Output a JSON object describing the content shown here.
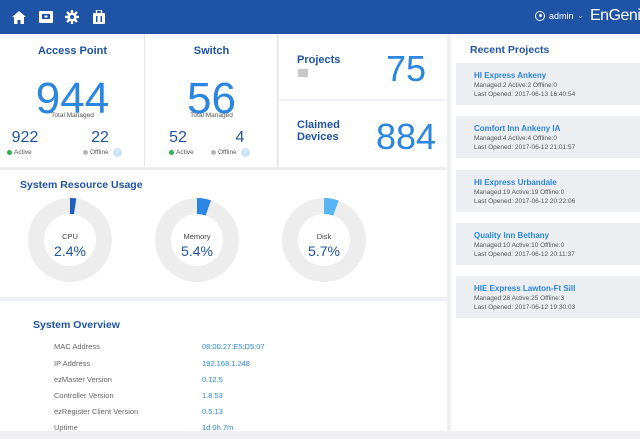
{
  "header": {
    "nav_icons": [
      "home-icon",
      "devices-icon",
      "gear-icon",
      "briefcase-icon"
    ],
    "user_label": "admin",
    "logo_text": "EnGenius",
    "bar_color": "#1f53a6"
  },
  "access_point": {
    "title": "Access Point",
    "total": "944",
    "total_label": "Total Managed",
    "active": "922",
    "active_label": "Active",
    "offline": "22",
    "offline_label": "Offline"
  },
  "switch": {
    "title": "Switch",
    "total": "56",
    "total_label": "Total Managed",
    "active": "52",
    "active_label": "Active",
    "offline": "4",
    "offline_label": "Offline"
  },
  "projects": {
    "label": "Projects",
    "value": "75"
  },
  "claimed_devices": {
    "label_line1": "Claimed",
    "label_line2": "Devices",
    "value": "884"
  },
  "resource_usage": {
    "title": "System Resource Usage",
    "gauges": [
      {
        "label": "CPU",
        "value": "2.4%",
        "fraction": 0.024
      },
      {
        "label": "Memory",
        "value": "5.4%",
        "fraction": 0.054
      },
      {
        "label": "Disk",
        "value": "5.7%",
        "fraction": 0.057
      }
    ]
  },
  "system_overview": {
    "title": "System Overview",
    "rows": [
      {
        "label": "MAC Address",
        "value": "08:00:27:E5:D5:07"
      },
      {
        "label": "IP Address",
        "value": "192.168.1.248"
      },
      {
        "label": "ezMaster Version",
        "value": "0.12.5"
      },
      {
        "label": "Controller Version",
        "value": "1.8.53"
      },
      {
        "label": "ezRegister Client Version",
        "value": "0.5.13"
      },
      {
        "label": "Uptime",
        "value": "1d 0h 7m"
      }
    ]
  },
  "recent_projects": {
    "title": "Recent Projects",
    "items": [
      {
        "name": "HI Express Ankeny",
        "stats": "Managed:2  Active:2  Offline:0",
        "last_opened": "Last Opened: 2017-06-13 16:40:54"
      },
      {
        "name": "Comfort Inn Ankeny IA",
        "stats": "Managed:4  Active:4  Offline:0",
        "last_opened": "Last Opened: 2017-06-12 21:01:57"
      },
      {
        "name": "HI Express Urbandale",
        "stats": "Managed:19  Active:19  Offline:0",
        "last_opened": "Last Opened: 2017-06-12 20:22:06"
      },
      {
        "name": "Quality Inn Bethany",
        "stats": "Managed:10  Active:10  Offline:0",
        "last_opened": "Last Opened: 2017-06-12 20:11:37"
      },
      {
        "name": "HIE Express Lawton-Ft Sill",
        "stats": "Managed:28  Active:25  Offline:3",
        "last_opened": "Last Opened: 2017-06-12 19:30:03"
      }
    ]
  },
  "colors": {
    "accent": "#2a86e0",
    "active": "#2bb24c",
    "offline": "#b5b5b5",
    "gauge_track": "#ededed"
  }
}
